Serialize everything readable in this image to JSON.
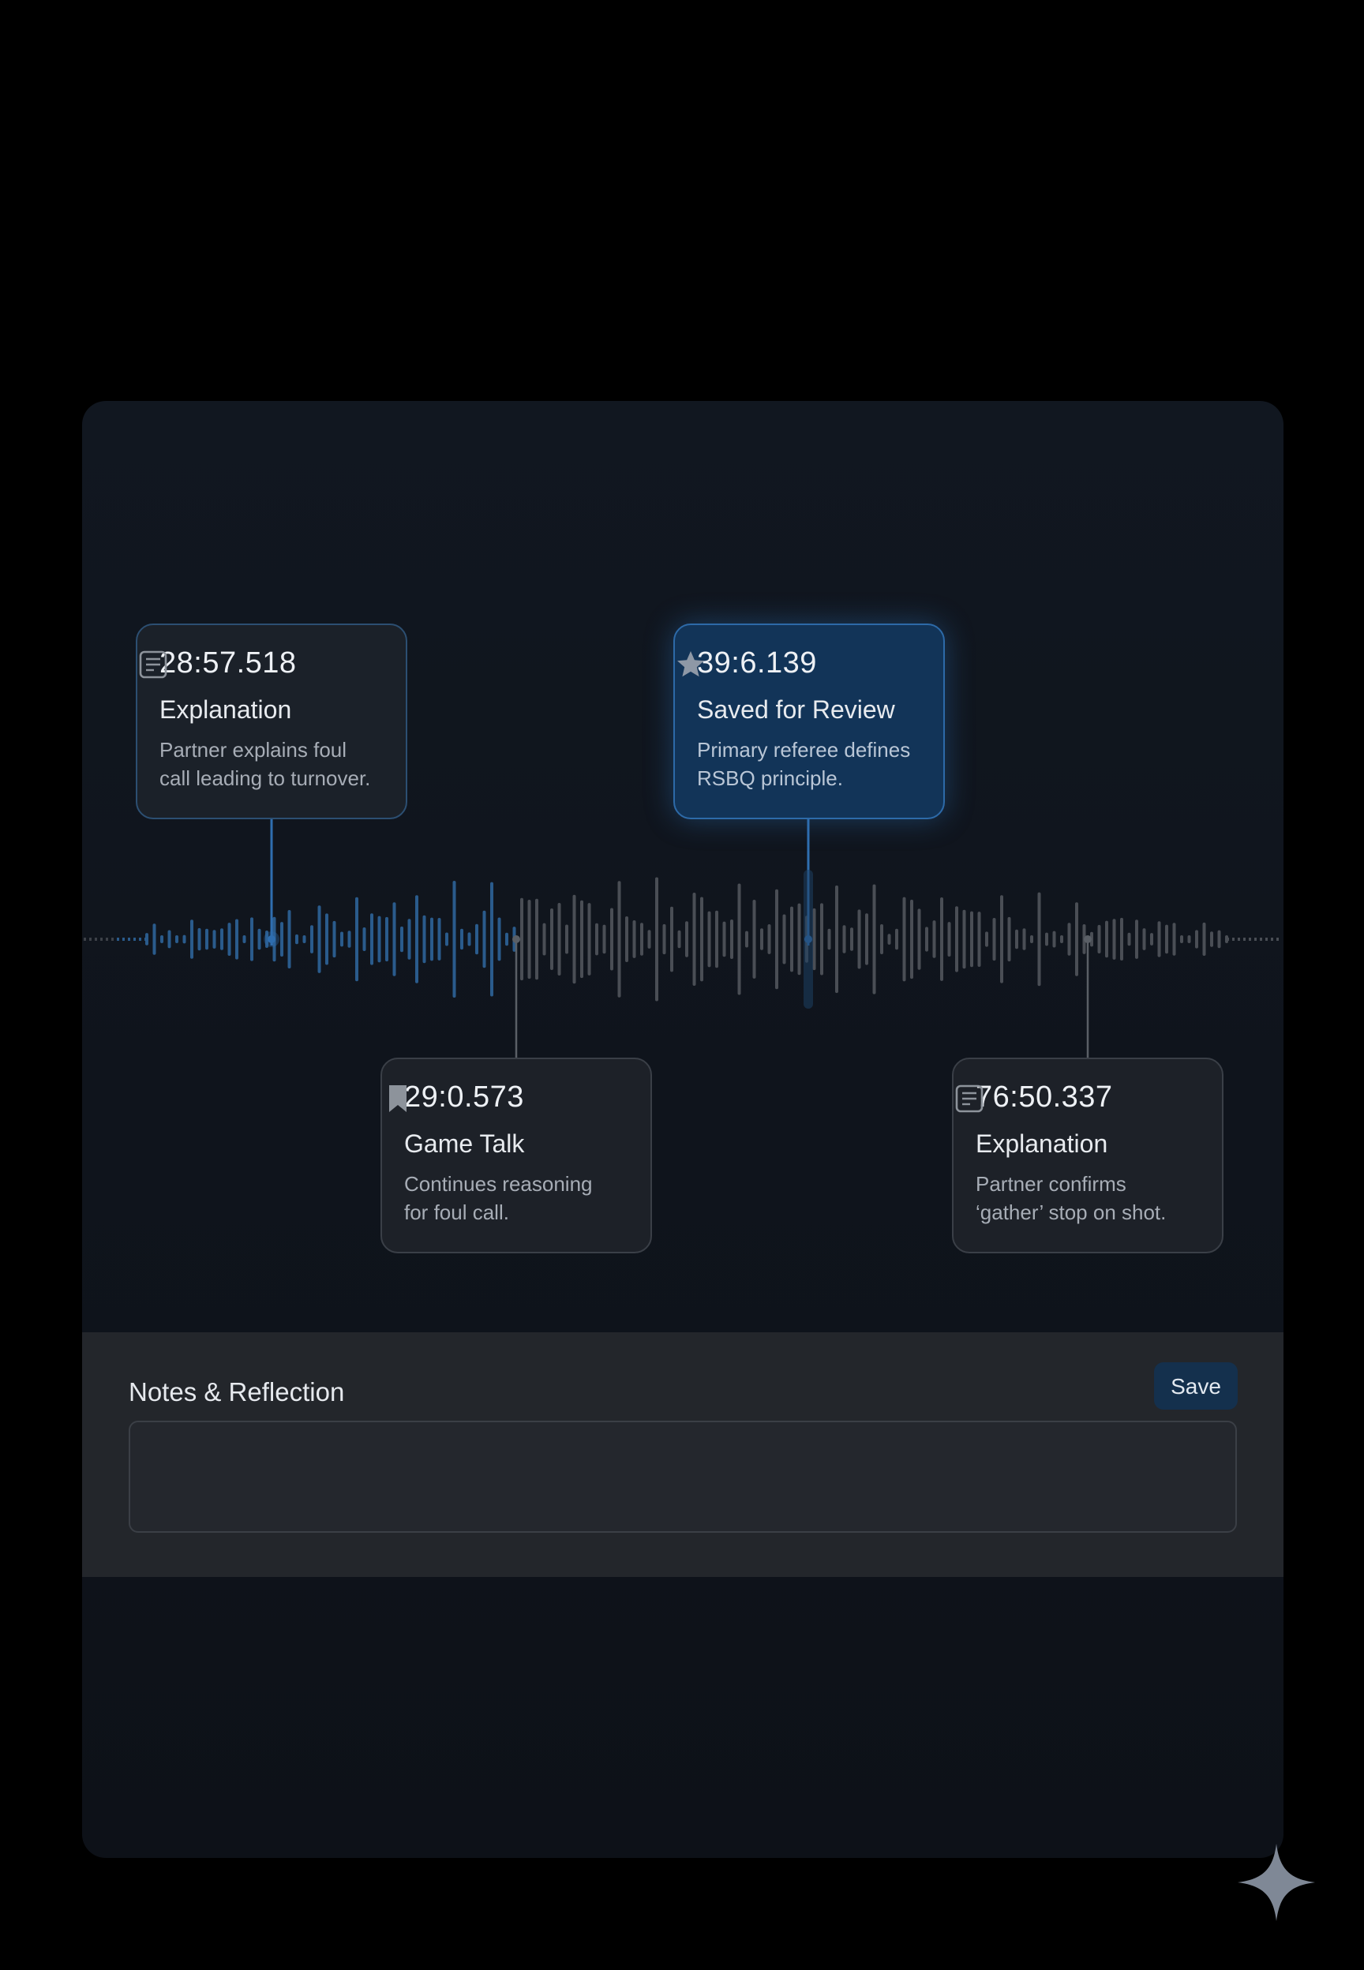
{
  "markers": [
    {
      "timestamp": "28:57.518",
      "category": "Explanation",
      "description_lines": [
        "Partner explains foul",
        "call leading to turnover."
      ],
      "icon": "note-icon",
      "state": "played"
    },
    {
      "timestamp": "39:6.139",
      "category": "Saved for Review",
      "description_lines": [
        "Primary referee defines",
        "RSBQ principle."
      ],
      "icon": "star-icon",
      "state": "active"
    },
    {
      "timestamp": "29:0.573",
      "category": "Game Talk",
      "description_lines": [
        "Continues reasoning",
        "for foul call."
      ],
      "icon": "bookmark-icon",
      "state": "default"
    },
    {
      "timestamp": "76:50.337",
      "category": "Explanation",
      "description_lines": [
        "Partner confirms",
        "‘gather’ stop on shot."
      ],
      "icon": "note-icon",
      "state": "default"
    }
  ],
  "playback": {
    "progress_fraction": 0.36
  },
  "notes": {
    "title": "Notes & Reflection",
    "save_label": "Save",
    "value": "",
    "placeholder": ""
  },
  "colors": {
    "accent_blue": "#2f6eb0",
    "active_card": "#123458",
    "waveform_played": "#2a5b8c",
    "waveform_idle": "#4a4e55",
    "panel": "#10151d",
    "notes_panel": "#23262b"
  },
  "decorations": {
    "corner_mark_icon": "sparkle-icon"
  }
}
